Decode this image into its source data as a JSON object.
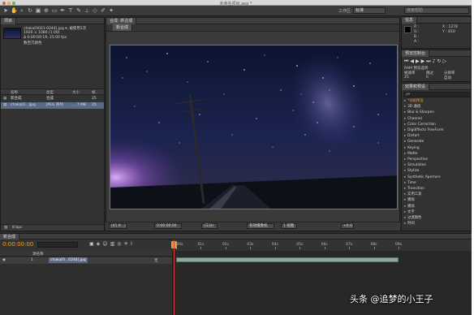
{
  "window": {
    "title": "未命名项目.aep *"
  },
  "toolbar": {
    "workspace_label": "工作区:",
    "workspace_value": "标准",
    "search_placeholder": "搜索帮助"
  },
  "project": {
    "tab": "项目",
    "file": {
      "name": "chaka[0001-0244].jpg ▾, 被使用1次",
      "dimensions": "1920 × 1080 (1.00)",
      "duration": "Δ 0:00:09:19, 25.00 fps",
      "color": "数百万颜色"
    },
    "columns": {
      "name": "名称",
      "type": "类型",
      "size": "大小",
      "fps": "帧..."
    },
    "items": [
      {
        "name": "新合成",
        "type": "合成",
        "size": "",
        "fps": "25"
      },
      {
        "name": "chaka[0...]jpg",
        "type": "JPEG 序列",
        "size": "... 7 MB",
        "fps": "25"
      }
    ],
    "footer_bpc": "8 bpc"
  },
  "composition": {
    "header": "合成: 新合成",
    "tab": "新合成",
    "bottom": {
      "zoom": "(41.9...)",
      "timecode": "0:00:00:00",
      "resolution": "(三分)",
      "view": "有效摄像机",
      "views": "1 视图",
      "offset": "+0.0"
    }
  },
  "info": {
    "tab": "信息",
    "r": "R :",
    "g": "G :",
    "b": "B :",
    "a": "A :",
    "x": "X : 1278",
    "y": "Y : 810"
  },
  "preview": {
    "tab": "预览控制台",
    "ram_label": "RAM 预览选项",
    "frame_rate_label": "帧速率",
    "skip_label": "跳过",
    "res_label": "分辨率",
    "frame_rate": "25",
    "skip": "0",
    "res": "自动"
  },
  "effects": {
    "tab": "效果和预设",
    "search_placeholder": "ρ▾",
    "categories": [
      "*动画预设",
      "3D 通道",
      "Blur & Sharpen",
      "Channel",
      "Color Correction",
      "DigiEffects FreeForm",
      "Distort",
      "Generate",
      "Keying",
      "Matte",
      "Perspective",
      "Simulation",
      "Stylize",
      "Synthetic Aperture",
      "Time",
      "Transition",
      "实用工具",
      "模拟",
      "模拟",
      "文字",
      "过渡颜色",
      "时间"
    ]
  },
  "timeline": {
    "tab": "新合成",
    "timecode": "0:00:00:00",
    "layer_num": "1",
    "layer_name": "chaka[0...0244].jpg",
    "source_label": "源名称",
    "parent": "无",
    "ruler": [
      "0:00s",
      "01s",
      "02s",
      "03s",
      "04s",
      "05s",
      "06s",
      "07s",
      "08s",
      "09s"
    ]
  },
  "watermark": "头条 @追梦的小王子",
  "colors": {
    "playhead": "#d83c3c",
    "layer_bar": "#8ea8a0",
    "selection": "#5a6a86"
  }
}
